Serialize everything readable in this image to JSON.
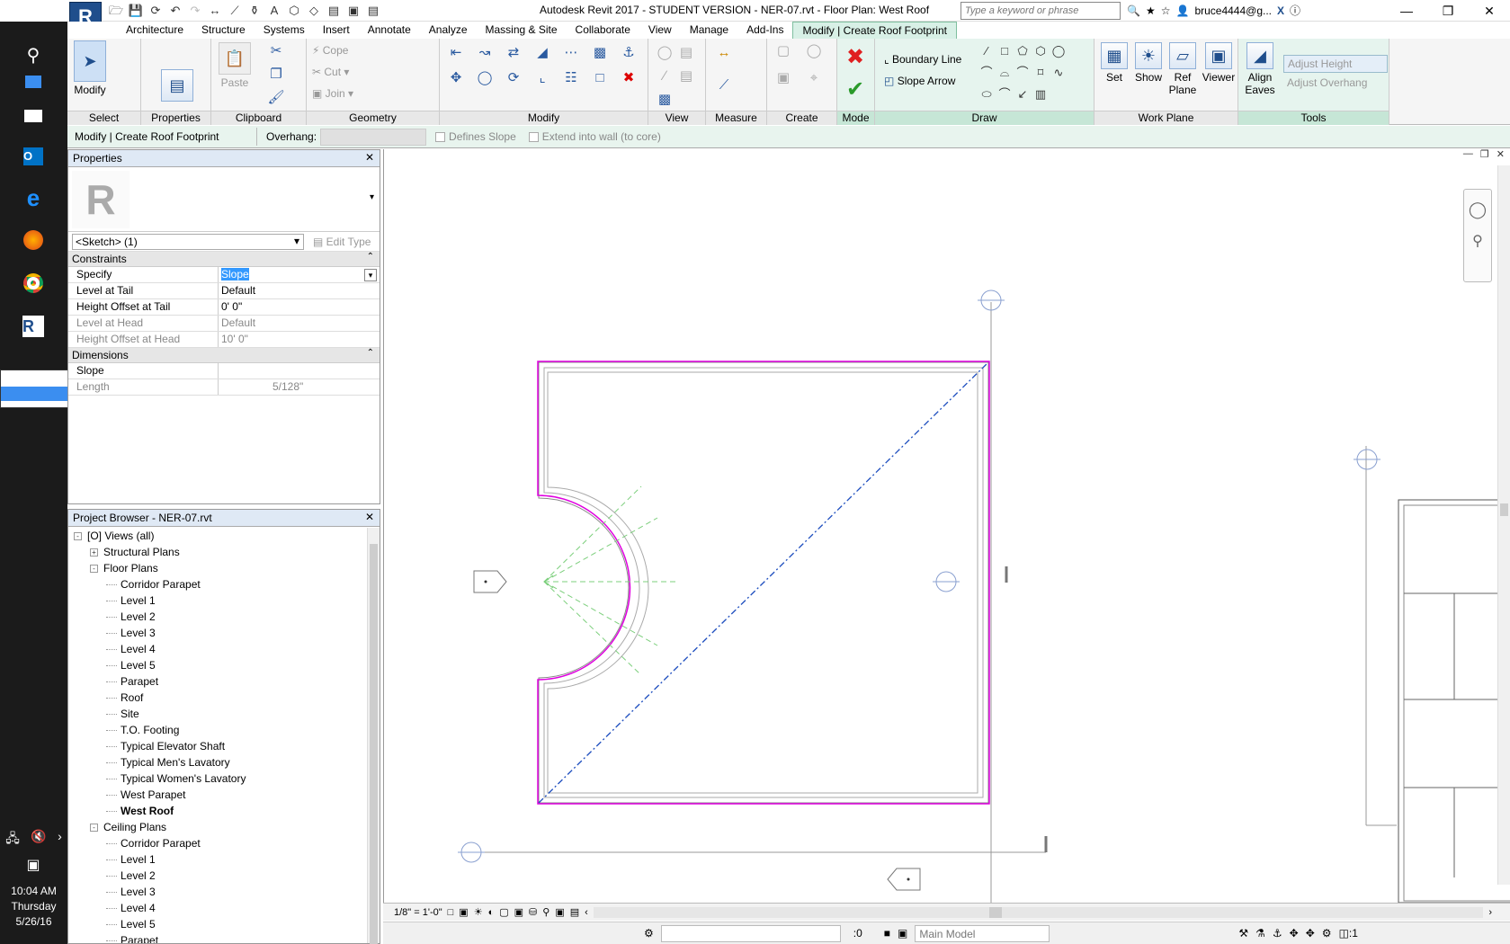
{
  "taskbar": {
    "icons": [
      "search-icon",
      "store-icon",
      "mail-icon",
      "outlook-icon",
      "edge-icon",
      "firefox-icon",
      "chrome-icon",
      "revit-icon"
    ],
    "time": "10:04 AM",
    "day": "Thursday",
    "date": "5/26/16"
  },
  "titlebar": {
    "app_letter": "R",
    "title": "Autodesk Revit 2017 - STUDENT VERSION -     NER-07.rvt - Floor Plan: West Roof",
    "search_placeholder": "Type a keyword or phrase",
    "user": "bruce4444@g..."
  },
  "tabs": [
    "Architecture",
    "Structure",
    "Systems",
    "Insert",
    "Annotate",
    "Analyze",
    "Massing & Site",
    "Collaborate",
    "View",
    "Manage",
    "Add-Ins",
    "Modify | Create Roof Footprint"
  ],
  "ribbon": {
    "select": {
      "label": "Select",
      "modify": "Modify"
    },
    "properties": {
      "label": "Properties"
    },
    "clipboard": {
      "label": "Clipboard",
      "paste": "Paste"
    },
    "geometry": {
      "label": "Geometry",
      "cope": "Cope",
      "cut": "Cut",
      "join": "Join"
    },
    "modify": {
      "label": "Modify"
    },
    "view": {
      "label": "View"
    },
    "measure": {
      "label": "Measure"
    },
    "create": {
      "label": "Create"
    },
    "mode": {
      "label": "Mode"
    },
    "draw": {
      "label": "Draw",
      "boundary_line": "Boundary Line",
      "slope_arrow": "Slope Arrow"
    },
    "workplane": {
      "label": "Work Plane",
      "set": "Set",
      "show": "Show",
      "ref_plane": "Ref Plane",
      "viewer": "Viewer"
    },
    "tools": {
      "label": "Tools",
      "align_eaves": "Align Eaves",
      "adjust_height": "Adjust Height",
      "adjust_overhang": "Adjust Overhang"
    }
  },
  "optionsbar": {
    "context": "Modify | Create Roof Footprint",
    "overhang_label": "Overhang:",
    "defines_slope": "Defines Slope",
    "extend": "Extend into wall (to core)"
  },
  "properties": {
    "title": "Properties",
    "instance": "<Sketch> (1)",
    "edit_type": "Edit Type",
    "constraints": "Constraints",
    "dimensions": "Dimensions",
    "rows": [
      {
        "name": "Specify",
        "value": "Slope"
      },
      {
        "name": "Level at Tail",
        "value": "Default"
      },
      {
        "name": "Height Offset at Tail",
        "value": "0'  0\""
      },
      {
        "name": "Level at Head",
        "value": "Default"
      },
      {
        "name": "Height Offset at Head",
        "value": "10'  0\""
      }
    ],
    "dim_rows": [
      {
        "name": "Slope",
        "value": ""
      },
      {
        "name": "Length",
        "value": "5/128\""
      }
    ]
  },
  "browser": {
    "title": "Project Browser - NER-07.rvt",
    "nodes": [
      {
        "label": "[O] Views (all)",
        "level": 0,
        "exp": "-"
      },
      {
        "label": "Structural Plans",
        "level": 1,
        "exp": "+"
      },
      {
        "label": "Floor Plans",
        "level": 1,
        "exp": "-"
      },
      {
        "label": "Corridor Parapet",
        "level": 2
      },
      {
        "label": "Level 1",
        "level": 2
      },
      {
        "label": "Level 2",
        "level": 2
      },
      {
        "label": "Level 3",
        "level": 2
      },
      {
        "label": "Level 4",
        "level": 2
      },
      {
        "label": "Level 5",
        "level": 2
      },
      {
        "label": "Parapet",
        "level": 2
      },
      {
        "label": "Roof",
        "level": 2
      },
      {
        "label": "Site",
        "level": 2
      },
      {
        "label": "T.O. Footing",
        "level": 2
      },
      {
        "label": "Typical Elevator Shaft",
        "level": 2
      },
      {
        "label": "Typical Men's Lavatory",
        "level": 2
      },
      {
        "label": "Typical Women's Lavatory",
        "level": 2
      },
      {
        "label": "West Parapet",
        "level": 2
      },
      {
        "label": "West Roof",
        "level": 2,
        "bold": true
      },
      {
        "label": "Ceiling Plans",
        "level": 1,
        "exp": "-"
      },
      {
        "label": "Corridor Parapet",
        "level": 2
      },
      {
        "label": "Level 1",
        "level": 2
      },
      {
        "label": "Level 2",
        "level": 2
      },
      {
        "label": "Level 3",
        "level": 2
      },
      {
        "label": "Level 4",
        "level": 2
      },
      {
        "label": "Level 5",
        "level": 2
      },
      {
        "label": "Parapet",
        "level": 2
      }
    ]
  },
  "viewbar": {
    "scale": "1/8\" = 1'-0\""
  },
  "statusbar": {
    "selected": ":0",
    "model": "Main Model",
    "filter": ":1"
  },
  "colors": {
    "sketch": "#e000e0",
    "slope_line": "#1f4fbf",
    "ribbon_context": "#d8f0e6",
    "arrow": "#ff0000"
  }
}
